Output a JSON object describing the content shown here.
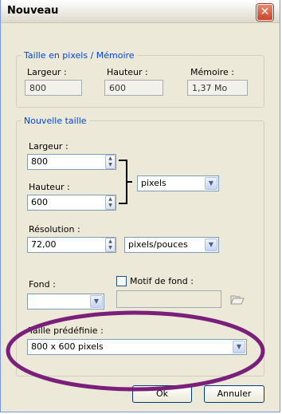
{
  "window": {
    "title": "Nouveau",
    "close_glyph": "✕"
  },
  "memory_group": {
    "legend": "Taille en pixels / Mémoire",
    "width_label": "Largeur :",
    "width_value": "800",
    "height_label": "Hauteur :",
    "height_value": "600",
    "memory_label": "Mémoire :",
    "memory_value": "1,37 Mo"
  },
  "new_size_group": {
    "legend": "Nouvelle taille",
    "width_label": "Largeur :",
    "width_value": "800",
    "height_label": "Hauteur :",
    "height_value": "600",
    "unit_selected": "pixels",
    "resolution_label": "Résolution :",
    "resolution_value": "72,00",
    "resolution_unit_selected": "pixels/pouces",
    "background_label": "Fond :",
    "pattern_label": "Motif de fond :",
    "preset_label": "Taille prédéfinie :",
    "preset_selected": "800 x 600 pixels"
  },
  "buttons": {
    "ok": "Ok",
    "cancel": "Annuler"
  },
  "colors": {
    "legend": "#0046d5",
    "dialog_bg": "#ece9d8",
    "highlight_ellipse": "#7a1f7a"
  },
  "icons": {
    "spin": "spinner-icon",
    "dropdown": "chevron-down-icon",
    "folder": "folder-open-icon",
    "close": "close-icon"
  }
}
